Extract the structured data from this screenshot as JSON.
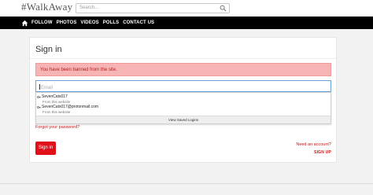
{
  "header": {
    "logo": "#WalkAway",
    "search_placeholder": "Search..."
  },
  "nav": {
    "items": [
      "FOLLOW",
      "PHOTOS",
      "VIDEOS",
      "POLLS",
      "CONTACT US"
    ]
  },
  "signin": {
    "title": "Sign in",
    "alert": "You have been banned from the site.",
    "email_placeholder": "Email",
    "autocomplete": {
      "items": [
        {
          "user": "SevenCats017",
          "source": "From this website"
        },
        {
          "user": "SevenCats017@protonmail.com",
          "source": "From this website"
        }
      ],
      "footer": "View Saved Logins"
    },
    "forgot": "Forgot your password?",
    "button": "Sign in",
    "need_account": "Need an account?",
    "signup": "SIGN UP"
  },
  "colors": {
    "accent": "#e0101a",
    "alert_bg": "#f7b4b4",
    "alert_text": "#b12020",
    "nav_bg": "#000000"
  }
}
